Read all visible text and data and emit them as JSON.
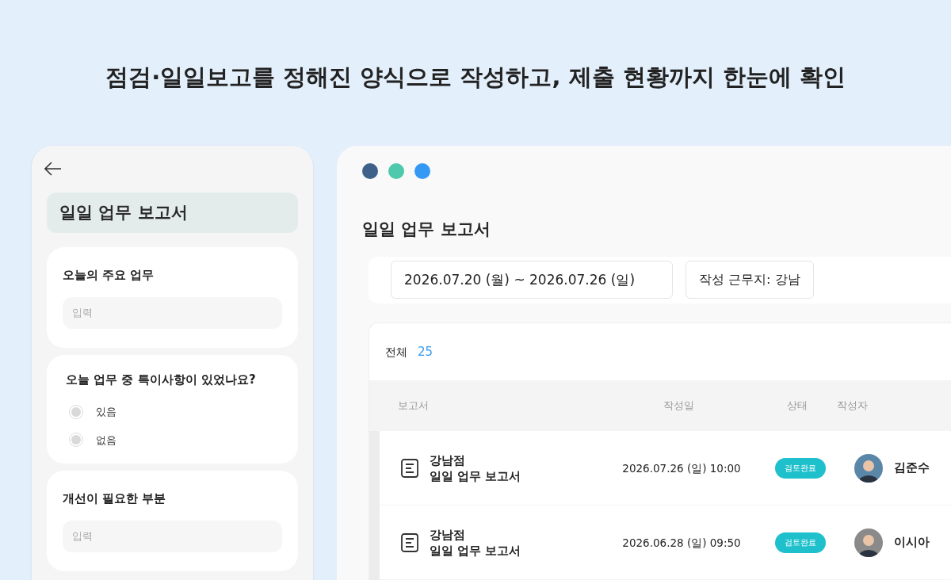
{
  "headline": "점검·일일보고를 정해진 양식으로 작성하고, 제출 현황까지 한눈에 확인",
  "mobile": {
    "title": "일일 업무 보고서",
    "sections": [
      {
        "kind": "input",
        "label": "오늘의 주요 업무",
        "placeholder": "입력"
      },
      {
        "kind": "radio",
        "label": "오늘 업무 중 특이사항이 있었나요?",
        "options": [
          {
            "label": "있음",
            "selected": false
          },
          {
            "label": "없음",
            "selected": false
          }
        ]
      },
      {
        "kind": "input",
        "label": "개선이 필요한 부분",
        "placeholder": "입력"
      }
    ]
  },
  "desktop": {
    "window_dots": [
      {
        "color": "#3d6189"
      },
      {
        "color": "#4ec9ac"
      },
      {
        "color": "#3399f5"
      }
    ],
    "title": "일일 업무 보고서",
    "filters": {
      "date_range": "2026.07.20 (월) ~ 2026.07.26 (일)",
      "location": "작성 근무지: 강남"
    },
    "total_label": "전체",
    "total_count": "25",
    "table": {
      "columns": [
        "보고서",
        "작성일",
        "상태",
        "작성자"
      ],
      "rows": [
        {
          "store": "강남점",
          "report": "일일 업무 보고서",
          "date": "2026.07.26 (일) 10:00",
          "status": "검토완료",
          "author": "김준수"
        },
        {
          "store": "강남점",
          "report": "일일 업무 보고서",
          "date": "2026.06.28 (일) 09:50",
          "status": "검토완료",
          "author": "이시아"
        }
      ]
    }
  }
}
